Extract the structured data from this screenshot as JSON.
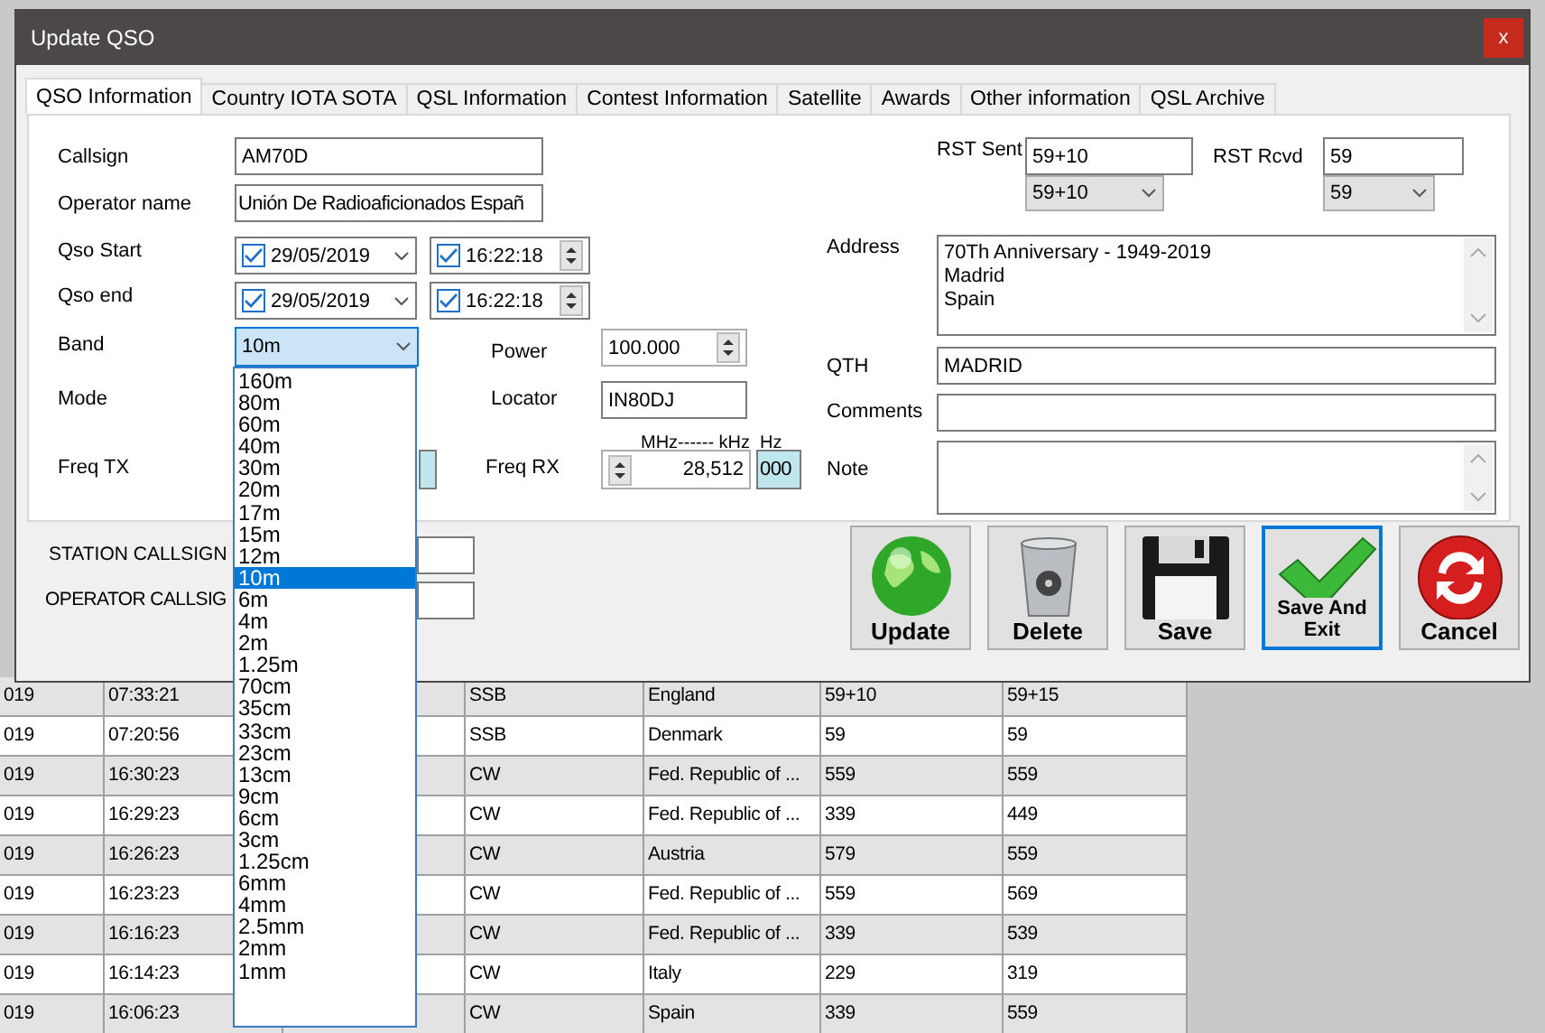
{
  "window": {
    "title": "Update QSO",
    "close_label": "x"
  },
  "tabs": [
    {
      "label": "QSO Information",
      "selected": true
    },
    {
      "label": "Country IOTA SOTA",
      "selected": false
    },
    {
      "label": "QSL Information",
      "selected": false
    },
    {
      "label": "Contest Information",
      "selected": false
    },
    {
      "label": "Satellite",
      "selected": false
    },
    {
      "label": "Awards",
      "selected": false
    },
    {
      "label": "Other information",
      "selected": false
    },
    {
      "label": "QSL Archive",
      "selected": false
    }
  ],
  "callsign": {
    "label": "Callsign",
    "value": "AM70D"
  },
  "operator_name": {
    "label": "Operator name",
    "value": "Unión De Radioaficionados Españ"
  },
  "qso_start": {
    "label": "Qso Start",
    "date": "29/05/2019",
    "date_checked": true,
    "time": "16:22:18",
    "time_checked": true
  },
  "qso_end": {
    "label": "Qso end",
    "date": "29/05/2019",
    "date_checked": true,
    "time": "16:22:18",
    "time_checked": true
  },
  "band": {
    "label": "Band",
    "value": "10m",
    "expanded": true,
    "options": [
      {
        "label": "160m",
        "selected": false
      },
      {
        "label": "80m",
        "selected": false
      },
      {
        "label": "60m",
        "selected": false
      },
      {
        "label": "40m",
        "selected": false
      },
      {
        "label": "30m",
        "selected": false
      },
      {
        "label": "20m",
        "selected": false
      },
      {
        "label": "17m",
        "selected": false
      },
      {
        "label": "15m",
        "selected": false
      },
      {
        "label": "12m",
        "selected": false
      },
      {
        "label": "10m",
        "selected": true
      },
      {
        "label": "6m",
        "selected": false
      },
      {
        "label": "4m",
        "selected": false
      },
      {
        "label": "2m",
        "selected": false
      },
      {
        "label": "1.25m",
        "selected": false
      },
      {
        "label": "70cm",
        "selected": false
      },
      {
        "label": "35cm",
        "selected": false
      },
      {
        "label": "33cm",
        "selected": false
      },
      {
        "label": "23cm",
        "selected": false
      },
      {
        "label": "13cm",
        "selected": false
      },
      {
        "label": "9cm",
        "selected": false
      },
      {
        "label": "6cm",
        "selected": false
      },
      {
        "label": "3cm",
        "selected": false
      },
      {
        "label": "1.25cm",
        "selected": false
      },
      {
        "label": "6mm",
        "selected": false
      },
      {
        "label": "4mm",
        "selected": false
      },
      {
        "label": "2.5mm",
        "selected": false
      },
      {
        "label": "2mm",
        "selected": false
      },
      {
        "label": "1mm",
        "selected": false
      }
    ]
  },
  "power": {
    "label": "Power",
    "value": "100.000"
  },
  "mode": {
    "label": "Mode"
  },
  "locator": {
    "label": "Locator",
    "value": "IN80DJ"
  },
  "freq_tx": {
    "label": "Freq TX"
  },
  "freq_rx": {
    "label": "Freq RX",
    "unit_caption": "MHz------ kHz",
    "hz_caption": "Hz",
    "value": "28,512",
    "hz_value": "000"
  },
  "rst_sent": {
    "label": "RST Sent",
    "value": "59+10",
    "choice": "59+10"
  },
  "rst_rcvd": {
    "label": "RST Rcvd",
    "value": "59",
    "choice": "59"
  },
  "address": {
    "label": "Address",
    "value": "70Th Anniversary - 1949-2019\nMadrid\nSpain"
  },
  "qth": {
    "label": "QTH",
    "value": "MADRID"
  },
  "comments": {
    "label": "Comments"
  },
  "note": {
    "label": "Note"
  },
  "station_callsign": {
    "label": "STATION CALLSIGN"
  },
  "operator_callsign": {
    "label": "OPERATOR CALLSIG"
  },
  "buttons": [
    {
      "kind": "update",
      "label": "Update",
      "focused": false
    },
    {
      "kind": "delete",
      "label": "Delete",
      "focused": false
    },
    {
      "kind": "save",
      "label": "Save",
      "focused": false
    },
    {
      "kind": "save_exit",
      "label": "Save And Exit",
      "focused": true
    },
    {
      "kind": "cancel",
      "label": "Cancel",
      "focused": false
    }
  ],
  "log_table": {
    "rows": [
      {
        "cells": [
          "019",
          "07:33:21",
          "SSB",
          "England",
          "59+10",
          "59+15"
        ]
      },
      {
        "cells": [
          "019",
          "07:20:56",
          "SSB",
          "Denmark",
          "59",
          "59"
        ]
      },
      {
        "cells": [
          "019",
          "16:30:23",
          "CW",
          "Fed. Republic of ...",
          "559",
          "559"
        ]
      },
      {
        "cells": [
          "019",
          "16:29:23",
          "CW",
          "Fed. Republic of ...",
          "339",
          "449"
        ]
      },
      {
        "cells": [
          "019",
          "16:26:23",
          "CW",
          "Austria",
          "579",
          "559"
        ]
      },
      {
        "cells": [
          "019",
          "16:23:23",
          "CW",
          "Fed. Republic of ...",
          "559",
          "569"
        ]
      },
      {
        "cells": [
          "019",
          "16:16:23",
          "CW",
          "Fed. Republic of ...",
          "339",
          "539"
        ]
      },
      {
        "cells": [
          "019",
          "16:14:23",
          "CW",
          "Italy",
          "229",
          "319"
        ]
      },
      {
        "cells": [
          "019",
          "16:06:23",
          "CW",
          "Spain",
          "339",
          "559"
        ]
      }
    ]
  }
}
